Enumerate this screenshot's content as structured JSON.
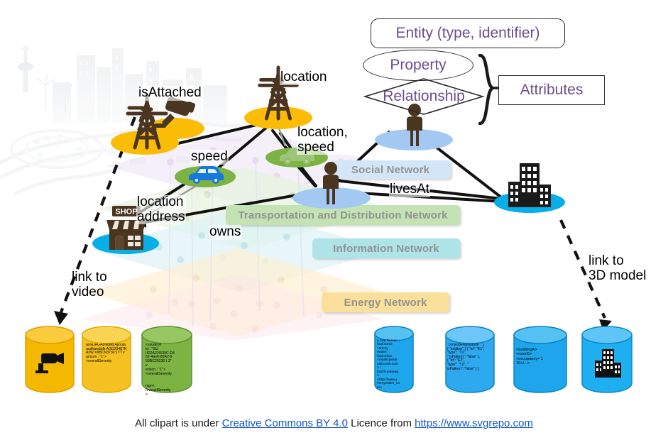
{
  "legend": {
    "entity": "Entity  (type, identifier)",
    "property": "Property",
    "relationship": "Relationship",
    "attributes": "Attributes",
    "accent_text_color": "#6B4E8A",
    "outline_color": "#2b2b2b"
  },
  "bands": [
    {
      "label": "Social Network",
      "color": "#D3E6F7"
    },
    {
      "label": "Transportation and Distribution Network",
      "color": "#C3E3B4"
    },
    {
      "label": "Information Network",
      "color": "#AEE3E8"
    },
    {
      "label": "Energy Network",
      "color": "#FBE09B"
    }
  ],
  "edge_labels": {
    "is_attached": "isAttached",
    "location": "location",
    "location_speed": "location,\nspeed",
    "speed": "speed",
    "location_address": "location\naddress",
    "owns": "owns",
    "lives_at": "livesAt",
    "link_to_video": "link to\nvideo",
    "link_to_3d_model": "link to\n3D model"
  },
  "nodes": [
    {
      "name": "tower-camera-node",
      "icon": "transmission-tower-icon",
      "platform_color": "#FBBC05"
    },
    {
      "name": "camera-node",
      "icon": "cctv-camera-icon",
      "platform_color": "#FBBC05"
    },
    {
      "name": "tower-node",
      "icon": "transmission-tower-icon",
      "platform_color": "#FBBC05"
    },
    {
      "name": "car-blue-node",
      "icon": "car-icon",
      "platform_color": "#7CB342"
    },
    {
      "name": "car-pale-node",
      "icon": "car-icon",
      "platform_color": "#7CB342"
    },
    {
      "name": "person-upper-node",
      "icon": "person-icon",
      "platform_color": "#A3C9F2"
    },
    {
      "name": "person-lower-node",
      "icon": "person-icon",
      "platform_color": "#A3C9F2"
    },
    {
      "name": "shop-node",
      "icon": "shop-icon",
      "platform_color": "#07AEE8",
      "sign": "SHOP"
    },
    {
      "name": "building-node",
      "icon": "office-building-icon",
      "platform_color": "#07AEE8"
    }
  ],
  "stores": [
    {
      "name": "video-store",
      "color": "#F5B800",
      "icon": "video-camera-icon",
      "text": ""
    },
    {
      "name": "binary-blob-store",
      "color": "#F5C120",
      "icon": "",
      "text": "asNDAGA8Nqwq Ajloudjaudhandsjfk AGD234$7NAzW X9BCN3730:1T? v\namzon : \"1\">\n<overallSeverity"
    },
    {
      "name": "situation-xml-store",
      "color": "#7CB342",
      "icon": "",
      "text": "<situation\nid : \"GU\nIID2A22/530C-D4\n52-4ae6-89A2-9\n93BC29230 I.3\"\nv\nersion : \"1\">\n<overallSeverity",
      "overflow_text": "high<\n/overallSeverity\n>"
    },
    {
      "name": "foaf-rdf-store",
      "color": "#1EA5EB",
      "icon": "",
      "text": "a foaf:Person ;\nfoaf:name\n\"Jimmy\nWales\" ;\nfoaf:mbox\n<mailto:jwale\ns@ocmk.com\n> ;\nfoaf:homepag\ne\n<http://www.j\nimmywales_co\nm>"
    },
    {
      "name": "ngsi-ld-registration-store",
      "color": "#2EA8EF",
      "icon": "",
      "text": "\"contextRegistration\" :   [\n{ \"entities\": [ { \"id\": \"E1\",\n     \"type\": \"T1\",\n\"  isPattern\":  \"false\" },\n   { \"id\": \"E2\",\n      \"type\": \"T2\", \"\nisPattern\":  \"false\" } ]."
    },
    {
      "name": "building-occupancy-store",
      "color": "#1EA5EB",
      "icon": "",
      "text": "<buildingA>\n   <room5>\n      <occupancy> 1\n                 10</...>"
    },
    {
      "name": "building-3d-model-store",
      "color": "#1FAFF0",
      "icon": "office-building-icon",
      "text": ""
    }
  ],
  "footer": {
    "prefix": "All clipart is under ",
    "licence_link": "Creative Commons BY 4.0",
    "middle": " Licence from ",
    "source_link": "https://www.svgrepo.com",
    "link_color": "#1155CC"
  }
}
